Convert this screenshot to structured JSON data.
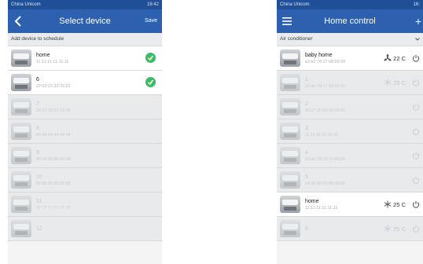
{
  "left": {
    "status": {
      "carrier": "China Unicom",
      "time": "16:42"
    },
    "title": "Select device",
    "save_label": "Save",
    "section_label": "Add device to schedule",
    "devices": [
      {
        "name": "home",
        "address": "11:11:11:11:11:11",
        "checked": true
      },
      {
        "name": "6",
        "address": "22:22:22:22:22:22",
        "checked": true
      },
      {
        "name": "7",
        "address": "33:33:33:33:33:33",
        "checked": false
      },
      {
        "name": "8",
        "address": "44:44:44:44:44:44",
        "checked": false
      },
      {
        "name": "9",
        "address": "99:99:99:99:99:99",
        "checked": false
      },
      {
        "name": "10",
        "address": "55:55:55:55:55:55",
        "checked": false
      },
      {
        "name": "11",
        "address": "77:77:77:77:77:77",
        "checked": false
      },
      {
        "name": "12",
        "address": "",
        "checked": false
      }
    ]
  },
  "right": {
    "status": {
      "carrier": "China Unicom",
      "time": "16:"
    },
    "title": "Home control",
    "category": "Air conditioner",
    "devices": [
      {
        "name": "baby home",
        "address": "a3:b1:78:17:00:00:00",
        "temp": "22 C",
        "mode": "fan",
        "enabled": true
      },
      {
        "name": "1",
        "address": "12:a0:78:17:00:00:00",
        "temp": "25 C",
        "mode": "snow",
        "enabled": false
      },
      {
        "name": "2",
        "address": "20:27:00:00:00:00:00",
        "temp": "",
        "mode": "",
        "enabled": false
      },
      {
        "name": "3",
        "address": "11:11:11:11:11:11",
        "temp": "",
        "mode": "",
        "enabled": false
      },
      {
        "name": "4",
        "address": "13:a0:78:19:7e:90:05",
        "temp": "",
        "mode": "",
        "enabled": false
      },
      {
        "name": "5",
        "address": "14:00:00:00:00:00:00",
        "temp": "",
        "mode": "",
        "enabled": false
      },
      {
        "name": "home",
        "address": "11:11:11:11:11:11",
        "temp": "25 C",
        "mode": "snow",
        "enabled": true
      },
      {
        "name": "6",
        "address": "",
        "temp": "25 C",
        "mode": "snow",
        "enabled": false
      }
    ]
  },
  "colors": {
    "header": "#2d61b0",
    "statusbar": "#1f4f97",
    "check": "#3fbb62"
  }
}
